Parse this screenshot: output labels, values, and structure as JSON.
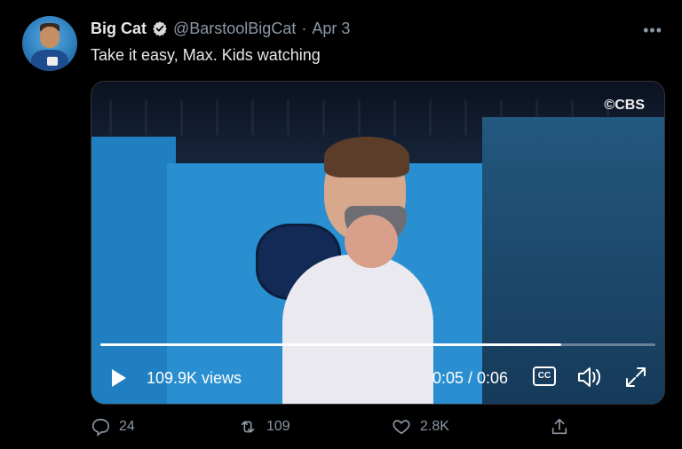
{
  "tweet": {
    "author_name": "Big Cat",
    "handle": "@BarstoolBigCat",
    "separator": "·",
    "date": "Apr 3",
    "text": "Take it easy, Max. Kids watching"
  },
  "video": {
    "network_label": "©CBS",
    "views": "109.9K views",
    "time": "0:05 / 0:06",
    "cc_label": "CC",
    "progress_fraction": 0.83
  },
  "actions": {
    "reply_count": "24",
    "retweet_count": "109",
    "like_count": "2.8K"
  },
  "icons": [
    "verified-badge-icon",
    "more-icon",
    "play-icon",
    "cc-icon",
    "volume-icon",
    "fullscreen-icon",
    "reply-icon",
    "retweet-icon",
    "like-icon",
    "share-icon"
  ]
}
